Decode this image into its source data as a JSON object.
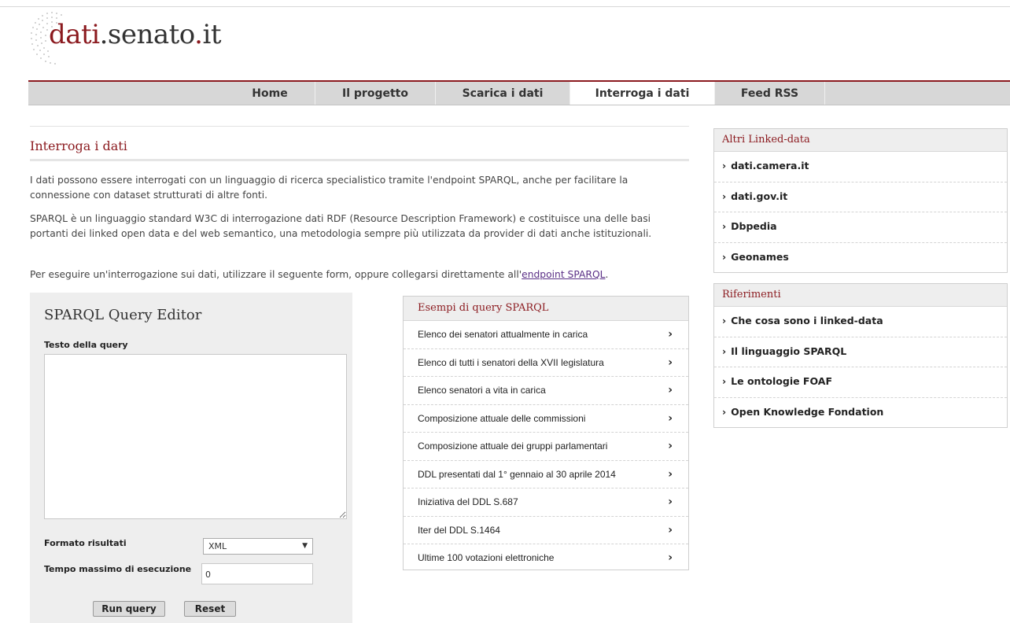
{
  "logo": {
    "part1": "dati",
    "part2": ".senato",
    "part3": ".",
    "part4": "it"
  },
  "nav": [
    "Home",
    "Il progetto",
    "Scarica i dati",
    "Interroga i dati",
    "Feed RSS"
  ],
  "nav_active": "Interroga i dati",
  "page": {
    "title": "Interroga i dati",
    "p1": "I dati possono essere interrogati con un linguaggio di ricerca specialistico tramite l'endpoint SPARQL, anche per facilitare la connessione con dataset strutturati di altre fonti.",
    "p2": "SPARQL è un linguaggio standard W3C di interrogazione dati RDF (Resource Description Framework) e costituisce una delle basi portanti dei linked open data e del web semantico, una metodologia sempre più utilizzata da provider di dati anche istituzionali.",
    "p3_text": "Per eseguire un'interrogazione sui dati, utilizzare il seguente form, oppure collegarsi direttamente all'",
    "p3_link": "endpoint SPARQL",
    "p3_end": "."
  },
  "editor": {
    "title": "SPARQL Query Editor",
    "query_label": "Testo della query",
    "query_value": "",
    "format_label": "Formato risultati",
    "format_value": "XML",
    "timeout_label": "Tempo massimo di esecuzione",
    "timeout_value": "0",
    "run_label": "Run query",
    "reset_label": "Reset"
  },
  "examples": {
    "title": "Esempi di query SPARQL",
    "items": [
      "Elenco dei senatori attualmente in carica",
      "Elenco di tutti i senatori della XVII legislatura",
      "Elenco senatori a vita in carica",
      "Composizione attuale delle commissioni",
      "Composizione attuale dei gruppi parlamentari",
      "DDL presentati dal 1° gennaio al 30 aprile 2014",
      "Iniziativa del DDL S.687",
      "Iter del DDL S.1464",
      "Ultime 100 votazioni elettroniche"
    ],
    "chevron": "›"
  },
  "linked": {
    "title": "Altri Linked-data",
    "items": [
      "dati.camera.it",
      "dati.gov.it",
      "Dbpedia",
      "Geonames"
    ]
  },
  "refs": {
    "title": "Riferimenti",
    "items": [
      "Che cosa sono i linked-data",
      "Il linguaggio SPARQL",
      "Le ontologie FOAF",
      "Open Knowledge Fondation"
    ]
  },
  "colors": {
    "accent": "#8b1a1f",
    "nav_bg": "#d7d7d7",
    "panel_bg": "#eeeeee",
    "link": "#5a2f86"
  }
}
